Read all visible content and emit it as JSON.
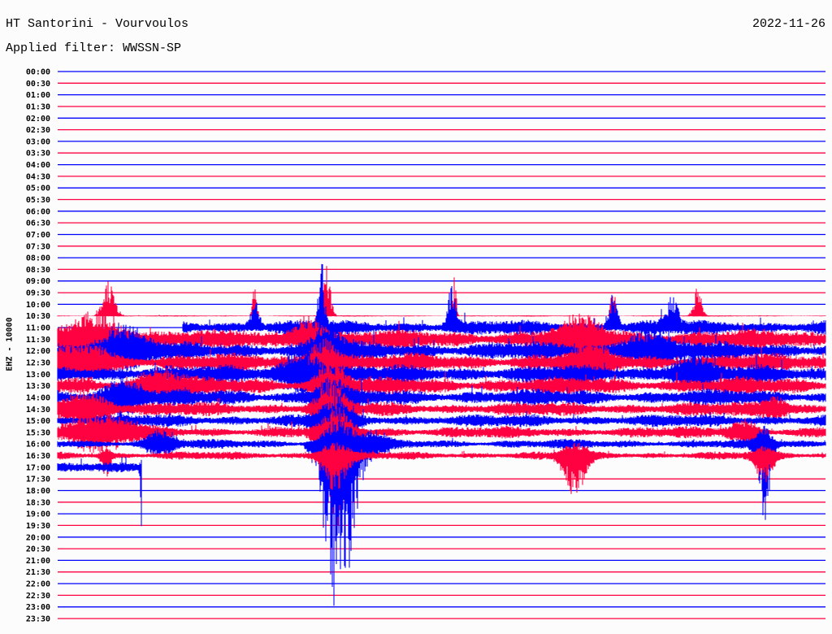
{
  "header": {
    "title": "HT Santorini - Vourvoulos",
    "filter": "Applied filter: WWSSN-SP",
    "date": "2022-11-26"
  },
  "colors": {
    "blue": "#0000ff",
    "red": "#ff0040",
    "background": "#fcfcfc"
  },
  "chart_data": {
    "type": "helicorder",
    "title": "HT Santorini - Vourvoulos",
    "date": "2022-11-26",
    "filter": "WWSSN-SP",
    "ylabel": "EHZ - 10000",
    "minutes_per_line": 30,
    "amplitude_units": "trace spacings",
    "data_end": {
      "line": "17:00",
      "minute": 3.3
    },
    "lines": [
      {
        "label": "00:00"
      },
      {
        "label": "00:30"
      },
      {
        "label": "01:00"
      },
      {
        "label": "01:30"
      },
      {
        "label": "02:00"
      },
      {
        "label": "02:30"
      },
      {
        "label": "03:00"
      },
      {
        "label": "03:30"
      },
      {
        "label": "04:00"
      },
      {
        "label": "04:30"
      },
      {
        "label": "05:00"
      },
      {
        "label": "05:30"
      },
      {
        "label": "06:00"
      },
      {
        "label": "06:30"
      },
      {
        "label": "07:00"
      },
      {
        "label": "07:30"
      },
      {
        "label": "08:00"
      },
      {
        "label": "08:30"
      },
      {
        "label": "09:00"
      },
      {
        "label": "09:30"
      },
      {
        "label": "10:00"
      },
      {
        "label": "10:30",
        "noise": 0.05,
        "events": [
          [
            2.0,
            3.0,
            0,
            0.3
          ],
          [
            7.7,
            3.0,
            0,
            0.1
          ],
          [
            10.5,
            4.5,
            0,
            0.2
          ],
          [
            15.5,
            3.5,
            0,
            0.1
          ],
          [
            21.7,
            3.5,
            0,
            0.1
          ],
          [
            25.0,
            2.5,
            0,
            0.2
          ]
        ]
      },
      {
        "label": "11:00",
        "noise": 0.65,
        "start": 4.9,
        "events": [
          [
            7.7,
            2.5,
            0,
            0.2
          ],
          [
            10.3,
            5.8,
            0,
            0.15
          ],
          [
            15.4,
            3.5,
            0,
            0.2
          ],
          [
            21.7,
            3.6,
            0,
            0.2
          ],
          [
            24.0,
            2.5,
            0,
            0.3
          ]
        ]
      },
      {
        "label": "11:30",
        "noise": 0.85,
        "events": [
          [
            1.5,
            2.0,
            2.0,
            1.2
          ],
          [
            9.8,
            2.0,
            1.0,
            0.6
          ],
          [
            20.5,
            1.5,
            1.5,
            1.0
          ]
        ]
      },
      {
        "label": "12:00",
        "noise": 0.8,
        "events": [
          [
            2.5,
            2.0,
            1.5,
            1.0
          ],
          [
            10.6,
            2.0,
            2.0,
            0.6
          ],
          [
            23.0,
            1.5,
            1.5,
            1.0
          ]
        ]
      },
      {
        "label": "12:30",
        "noise": 0.8,
        "events": [
          [
            1.0,
            1.5,
            1.5,
            1.0
          ],
          [
            10.4,
            2.0,
            2.5,
            0.6
          ],
          [
            20.8,
            1.5,
            1.5,
            0.8
          ]
        ]
      },
      {
        "label": "13:00",
        "noise": 0.8,
        "events": [
          [
            9.6,
            2.0,
            2.0,
            0.8
          ],
          [
            24.7,
            1.5,
            1.0,
            0.8
          ]
        ]
      },
      {
        "label": "13:30",
        "noise": 0.75,
        "events": [
          [
            4.0,
            1.0,
            1.0,
            1.0
          ],
          [
            10.7,
            2.0,
            3.0,
            0.6
          ]
        ]
      },
      {
        "label": "14:00",
        "noise": 0.7,
        "events": [
          [
            2.5,
            1.5,
            1.5,
            0.8
          ],
          [
            10.7,
            1.5,
            3.0,
            0.6
          ]
        ]
      },
      {
        "label": "14:30",
        "noise": 0.6,
        "events": [
          [
            1.0,
            1.5,
            1.5,
            1.0
          ],
          [
            10.7,
            2.0,
            4.0,
            0.6
          ],
          [
            28.0,
            1.0,
            1.0,
            0.5
          ]
        ]
      },
      {
        "label": "15:00",
        "noise": 0.55,
        "events": [
          [
            10.8,
            2.0,
            6.0,
            0.6
          ]
        ]
      },
      {
        "label": "15:30",
        "noise": 0.5,
        "events": [
          [
            1.5,
            1.5,
            1.5,
            1.5
          ],
          [
            10.9,
            2.0,
            8.0,
            0.6
          ],
          [
            26.8,
            1.0,
            1.0,
            0.6
          ]
        ]
      },
      {
        "label": "16:00",
        "noise": 0.4,
        "events": [
          [
            4.0,
            1.0,
            1.0,
            0.6
          ],
          [
            12.4,
            1.0,
            1.0,
            0.5
          ],
          [
            27.6,
            1.5,
            6.5,
            0.3
          ],
          [
            11.0,
            2.0,
            15.5,
            0.7
          ]
        ]
      },
      {
        "label": "16:30",
        "noise": 0.35,
        "events": [
          [
            1.9,
            0.5,
            2.0,
            0.2
          ],
          [
            10.8,
            1.0,
            3.0,
            0.6
          ],
          [
            20.2,
            1.0,
            3.5,
            0.5
          ],
          [
            27.6,
            0.6,
            2.0,
            0.4
          ]
        ]
      },
      {
        "label": "17:00",
        "noise": 0.4,
        "end": 3.3,
        "events": [
          [
            3.3,
            0.5,
            6.5,
            0.08
          ]
        ]
      },
      {
        "label": "17:30"
      },
      {
        "label": "18:00"
      },
      {
        "label": "18:30"
      },
      {
        "label": "19:00"
      },
      {
        "label": "19:30"
      },
      {
        "label": "20:00"
      },
      {
        "label": "20:30"
      },
      {
        "label": "21:00"
      },
      {
        "label": "21:30"
      },
      {
        "label": "22:00"
      },
      {
        "label": "22:30"
      },
      {
        "label": "23:00"
      },
      {
        "label": "23:30"
      }
    ]
  }
}
